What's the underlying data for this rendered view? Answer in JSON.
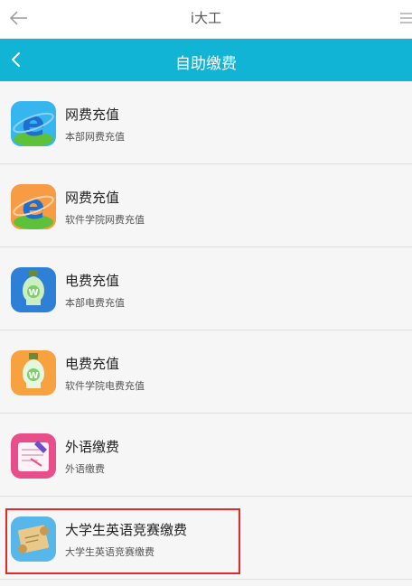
{
  "app": {
    "title": "i大工"
  },
  "header": {
    "title": "自助缴费"
  },
  "items": [
    {
      "name": "网费充值",
      "sub": "本部网费充值",
      "icon": "ie-globe-icon"
    },
    {
      "name": "网费充值",
      "sub": "软件学院网费充值",
      "icon": "ie-globe-icon"
    },
    {
      "name": "电费充值",
      "sub": "本部电费充值",
      "icon": "lightbulb-icon"
    },
    {
      "name": "电费充值",
      "sub": "软件学院电费充值",
      "icon": "lightbulb-icon"
    },
    {
      "name": "外语缴费",
      "sub": "外语缴费",
      "icon": "notebook-icon"
    },
    {
      "name": "大学生英语竞赛缴费",
      "sub": "大学生英语竞赛缴费",
      "icon": "scroll-icon"
    }
  ],
  "colors": {
    "header": "#11b4d5",
    "highlight": "#e02b2b"
  }
}
